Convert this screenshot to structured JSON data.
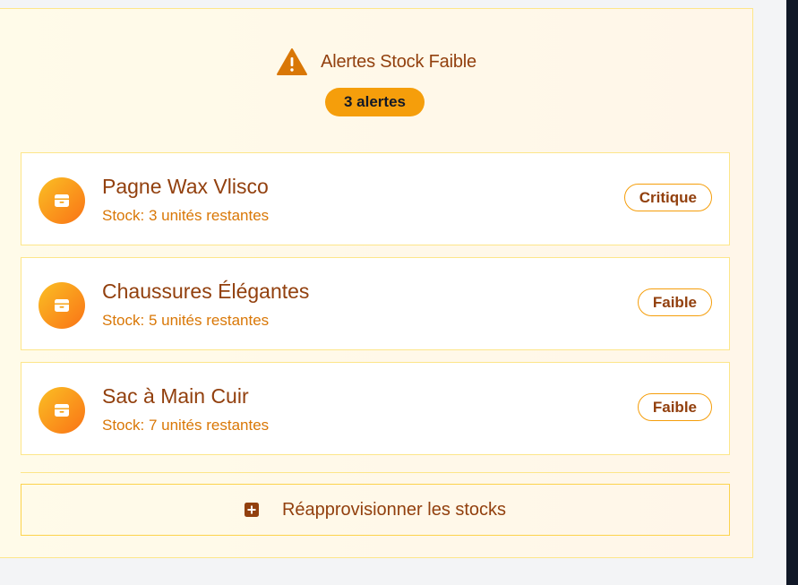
{
  "alerts": {
    "title": "Alertes Stock Faible",
    "count_badge": "3 alertes",
    "items": [
      {
        "name": "Pagne Wax Vlisco",
        "stock": "Stock: 3 unités restantes",
        "level": "Critique"
      },
      {
        "name": "Chaussures Élégantes",
        "stock": "Stock: 5 unités restantes",
        "level": "Faible"
      },
      {
        "name": "Sac à Main Cuir",
        "stock": "Stock: 7 unités restantes",
        "level": "Faible"
      }
    ],
    "restock_label": "Réapprovisionner les stocks"
  },
  "icons": {
    "header": "warning-triangle-icon",
    "item": "archive-box-icon",
    "restock": "plus-square-icon"
  },
  "colors": {
    "accent": "#f59e0b",
    "accent_dark": "#92400e",
    "stock_text": "#d97706",
    "panel_border": "#fde68a",
    "panel_bg": "#fffbe9"
  }
}
